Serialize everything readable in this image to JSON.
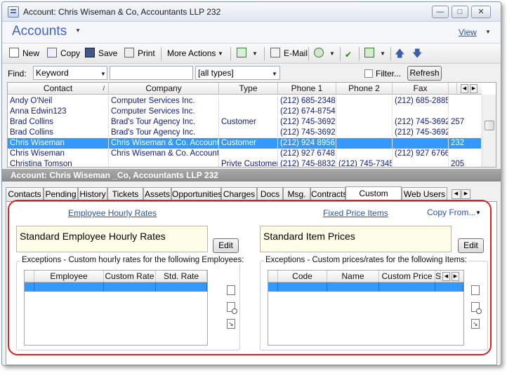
{
  "window": {
    "title": "Account:  Chris Wiseman & Co, Accountants LLP 232"
  },
  "header": {
    "title": "Accounts",
    "view_label": "View"
  },
  "toolbar": {
    "new_label": "New",
    "copy_label": "Copy",
    "save_label": "Save",
    "print_label": "Print",
    "more_actions_label": "More Actions",
    "email_label": "E-Mail"
  },
  "find": {
    "label": "Find:",
    "field_value": "Keyword",
    "search_value": "",
    "type_value": "[all types]",
    "filter_label": "Filter...",
    "refresh_label": "Refresh"
  },
  "grid": {
    "columns": [
      "Contact",
      "Company",
      "Type",
      "Phone 1",
      "Phone 2",
      "Fax",
      ""
    ],
    "rows": [
      [
        "Andy O'Neil",
        "Computer Services Inc.",
        "",
        "(212) 685-2348",
        "",
        "(212) 685-2885",
        ""
      ],
      [
        "Anna Edwin123",
        "Computer Services Inc.",
        "",
        "(212) 674-8754",
        "",
        "",
        ""
      ],
      [
        "Brad Collins",
        "Brad's Tour  Agency Inc.",
        "Customer",
        "(212) 745-3692",
        "",
        "(212) 745-3692",
        "257"
      ],
      [
        "Brad Collins",
        "Brad's Tour  Agency Inc.",
        "",
        "(212) 745-3692",
        "",
        "(212) 745-3692",
        ""
      ],
      [
        "Chris Wiseman",
        "Chris Wiseman & Co. Accountants",
        "Customer",
        "(212) 924 8956",
        "",
        "",
        "232"
      ],
      [
        "Chris Wiseman",
        "Chris Wiseman & Co. Accountants",
        "",
        "(212) 927 6748",
        "",
        "(212) 927 6766",
        ""
      ],
      [
        "Christina Tomson",
        "",
        "Privte Customer",
        "(212) 745-8832",
        "(212) 745-7345",
        "",
        "205"
      ]
    ],
    "selected_row": 4
  },
  "account_bar": {
    "label": "Account:  Chris Wiseman _Co, Accountants LLP 232"
  },
  "tabs": [
    {
      "label": "Contacts"
    },
    {
      "label": "Pending"
    },
    {
      "label": "History"
    },
    {
      "label": "Tickets"
    },
    {
      "label": "Assets"
    },
    {
      "label": "Opportunities"
    },
    {
      "label": "Charges"
    },
    {
      "label": "Docs"
    },
    {
      "label": "Msg."
    },
    {
      "label": "Contracts"
    },
    {
      "label": "Custom Pricing"
    },
    {
      "label": "Web Users"
    }
  ],
  "active_tab": 10,
  "pricing": {
    "hourly_link": "Employee Hourly Rates",
    "fixed_link": "Fixed Price Items",
    "copy_from_label": "Copy From...",
    "hourly_box_text": "Standard Employee Hourly Rates",
    "items_box_text": "Standard Item Prices",
    "edit_label": "Edit",
    "employees_group_title": "Exceptions - Custom hourly rates for the following Employees:",
    "items_group_title": "Exceptions - Custom prices/rates for the following Items:",
    "employee_columns": [
      "",
      "Employee",
      "Custom Rate",
      "Std. Rate"
    ],
    "item_columns": [
      "",
      "Code",
      "Name",
      "Custom Price",
      "S"
    ]
  }
}
